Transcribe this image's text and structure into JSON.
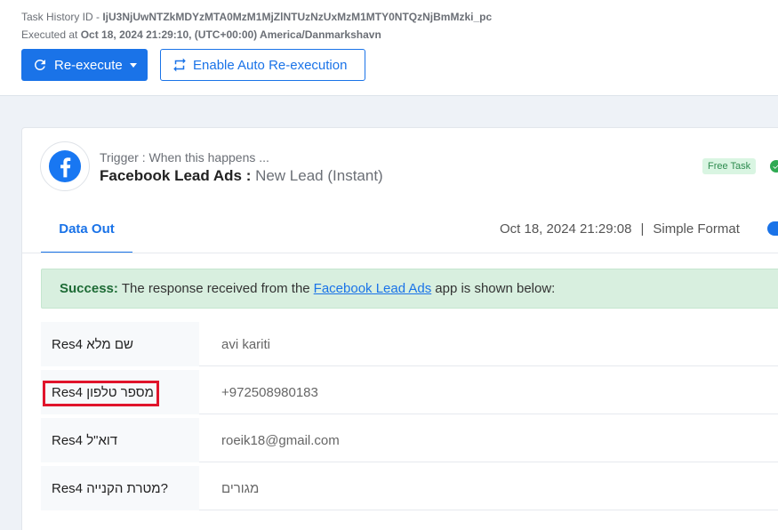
{
  "header": {
    "task_id_label": "Task History ID - ",
    "task_id_value": "IjU3NjUwNTZkMDYzMTA0MzM1MjZlNTUzNzUxMzM1MTY0NTQzNjBmMzki_pc",
    "executed_label": "Executed at ",
    "executed_value": "Oct 18, 2024 21:29:10, (UTC+00:00) America/Danmarkshavn"
  },
  "toolbar": {
    "reexecute_label": "Re-execute",
    "auto_reexecute_label": "Enable Auto Re-execution"
  },
  "trigger": {
    "subtitle": "Trigger : When this happens ...",
    "app_name": "Facebook Lead Ads : ",
    "event_name": "New Lead (Instant)",
    "badge": "Free Task",
    "brand_color": "#1877f2"
  },
  "tabs": {
    "data_out": "Data Out",
    "timestamp": "Oct 18, 2024 21:29:08",
    "separator": "|",
    "format_label": "Simple Format"
  },
  "success": {
    "label": "Success:",
    "text_before": "The response received from the",
    "link": "Facebook Lead Ads",
    "text_after": "app is shown below:"
  },
  "fields": [
    {
      "key": "Res4 שם מלא",
      "value": "avi kariti"
    },
    {
      "key": "Res4 מספר טלפון",
      "value": "+972508980183"
    },
    {
      "key": "Res4 דוא\"ל",
      "value": "roeik18@gmail.com"
    },
    {
      "key": "Res4 מטרת הקנייה?",
      "value": "מגורים"
    }
  ],
  "colors": {
    "accent": "#1a73e8",
    "success_bg": "#d8efdf",
    "highlight": "#e0142b"
  }
}
